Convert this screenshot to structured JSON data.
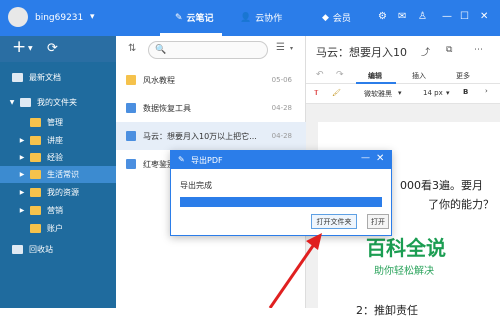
{
  "topbar": {
    "username": "bing69231",
    "tabs": [
      {
        "label": "云笔记",
        "icon": "pencil-icon"
      },
      {
        "label": "云协作",
        "icon": "user-icon"
      },
      {
        "label": "会员",
        "icon": "diamond-icon"
      }
    ],
    "window_icons": [
      "gear-icon",
      "mail-icon",
      "shirt-icon",
      "minimize-icon",
      "maximize-icon",
      "close-icon"
    ]
  },
  "sidebar": {
    "items": [
      {
        "label": "最新文档",
        "type": "doc"
      },
      {
        "label": "我的文件夹",
        "type": "folder-root"
      },
      {
        "label": "管理",
        "type": "folder"
      },
      {
        "label": "讲座",
        "type": "folder"
      },
      {
        "label": "经验",
        "type": "folder"
      },
      {
        "label": "生活常识",
        "type": "folder",
        "selected": true
      },
      {
        "label": "我的资源",
        "type": "folder"
      },
      {
        "label": "营销",
        "type": "folder"
      },
      {
        "label": "账户",
        "type": "folder"
      },
      {
        "label": "回收站",
        "type": "trash"
      }
    ]
  },
  "list": {
    "rows": [
      {
        "title": "风水教程",
        "date": "05-06",
        "type": "folder"
      },
      {
        "title": "数据恢复工具",
        "date": "04-28",
        "type": "note"
      },
      {
        "title": "马云：想要月入10万以上把它...",
        "date": "04-28",
        "type": "note",
        "selected": true
      },
      {
        "title": "红枣鉴别",
        "date": "",
        "type": "note"
      }
    ]
  },
  "editor": {
    "title": "马云：想要月入10",
    "tabs": [
      "编辑",
      "插入",
      "更多"
    ],
    "font": "微软雅黑",
    "font_size": "14 px",
    "bold_label": "B",
    "text_lines": [
      "000看3遍。要月",
      "了你的能力？",
      "2：推卸责任"
    ]
  },
  "dialog": {
    "title": "导出PDF",
    "status": "导出完成",
    "progress": 1.0,
    "open_folder_label": "打开文件夹",
    "open_label": "打开"
  },
  "watermark": {
    "big": "百科全说",
    "small": "助你轻松解决"
  }
}
